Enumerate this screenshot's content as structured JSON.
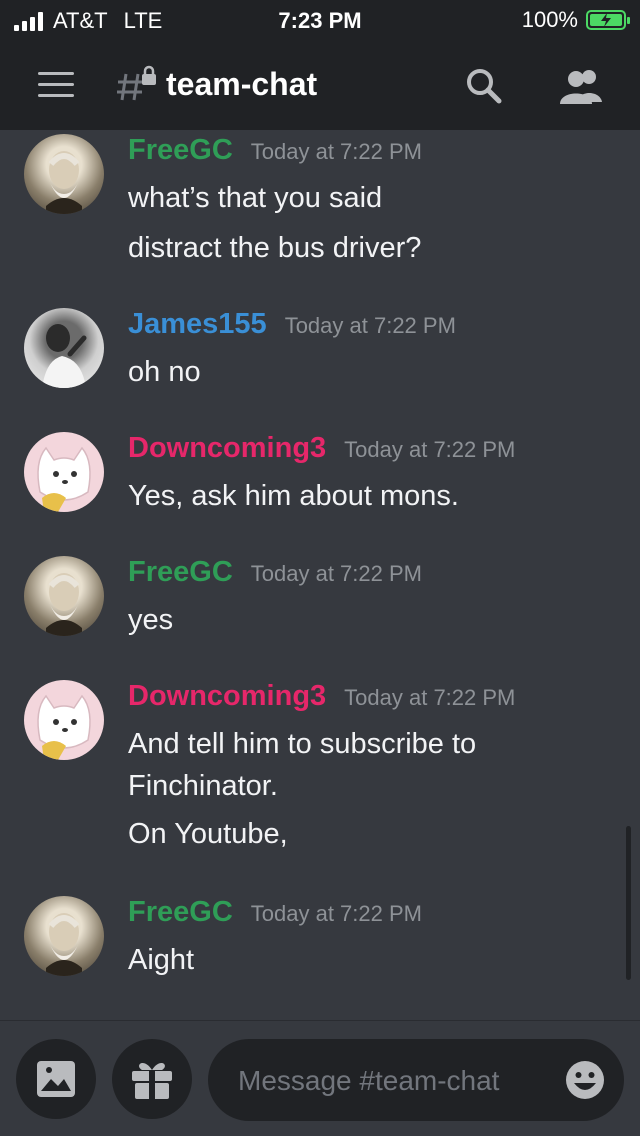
{
  "status_bar": {
    "carrier": "AT&T",
    "network": "LTE",
    "time": "7:23 PM",
    "battery": "100%",
    "battery_level": 1.0,
    "battery_color": "#4cd964"
  },
  "header": {
    "channel_name": "team-chat",
    "icons": [
      "menu-icon",
      "locked-channel-icon",
      "search-icon",
      "members-icon"
    ]
  },
  "messages": [
    {
      "author": "FreeGC",
      "time": "Today at 7:22 PM",
      "lines": [
        "what’s that you said",
        "distract the bus driver?"
      ]
    },
    {
      "author": "James155",
      "time": "Today at 7:22 PM",
      "lines": [
        "oh no"
      ]
    },
    {
      "author": "Downcoming3",
      "time": "Today at 7:22 PM",
      "lines": [
        "Yes, ask him about mons."
      ]
    },
    {
      "author": "FreeGC",
      "time": "Today at 7:22 PM",
      "lines": [
        "yes"
      ]
    },
    {
      "author": "Downcoming3",
      "time": "Today at 7:22 PM",
      "lines": [
        "And tell him to subscribe to",
        "Finchinator.",
        "On Youtube,"
      ]
    },
    {
      "author": "FreeGC",
      "time": "Today at 7:22 PM",
      "lines": [
        "Aight"
      ]
    }
  ],
  "colors": {
    "FreeGC": "#2f9e57",
    "James155": "#3a8fd6",
    "Downcoming3": "#e6276a"
  },
  "composer": {
    "placeholder": "Message #team-chat",
    "icons": [
      "image-icon",
      "gift-icon",
      "emoji-icon"
    ]
  }
}
